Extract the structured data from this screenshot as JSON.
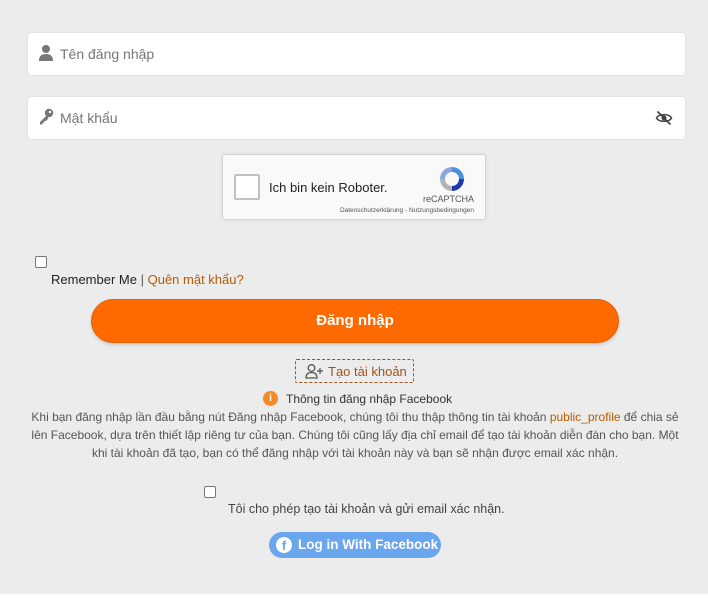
{
  "form": {
    "username_placeholder": "Tên đăng nhập",
    "password_placeholder": "Mật khẩu"
  },
  "captcha": {
    "label": "Ich bin kein Roboter.",
    "brand": "reCAPTCHA",
    "links": "Datenschutzerklärung - Nutzungsbedingungen"
  },
  "remember": {
    "label": "Remember Me",
    "separator": "|",
    "forgot_link": "Quên mật khẩu?"
  },
  "login_button": "Đăng nhập",
  "create_account_button": "Tạo tài khoản",
  "facebook_info": {
    "title": "Thông tin đăng nhập Facebook",
    "text_before": "Khi bạn đăng nhập lần đầu bằng nút Đăng nhập Facebook, chúng tôi thu thập thông tin tài khoản ",
    "highlight": "public_profile",
    "text_after": " để chia sẻ lên Facebook, dựa trên thiết lập riêng tư của bạn. Chúng tôi cũng lấy địa chỉ email để tạo tài khoản diễn đàn cho bạn. Một khi tài khoản đã tạo, bạn có thể đăng nhập với tài khoản này và bạn sẽ nhận được email xác nhận."
  },
  "consent_label": "Tôi cho phép tạo tài khoản và gửi email xác nhận.",
  "facebook_button": "Log in With Facebook",
  "icons": {
    "user": "user-icon",
    "key": "key-icon",
    "eye": "eye-slash-icon",
    "recaptcha": "recaptcha-logo-icon",
    "add_user": "user-plus-icon",
    "info": "info-icon",
    "facebook": "facebook-icon"
  },
  "colors": {
    "accent": "#ff6a00",
    "link": "#b85a00",
    "facebook": "#6aa6ee",
    "background": "#ececec"
  }
}
